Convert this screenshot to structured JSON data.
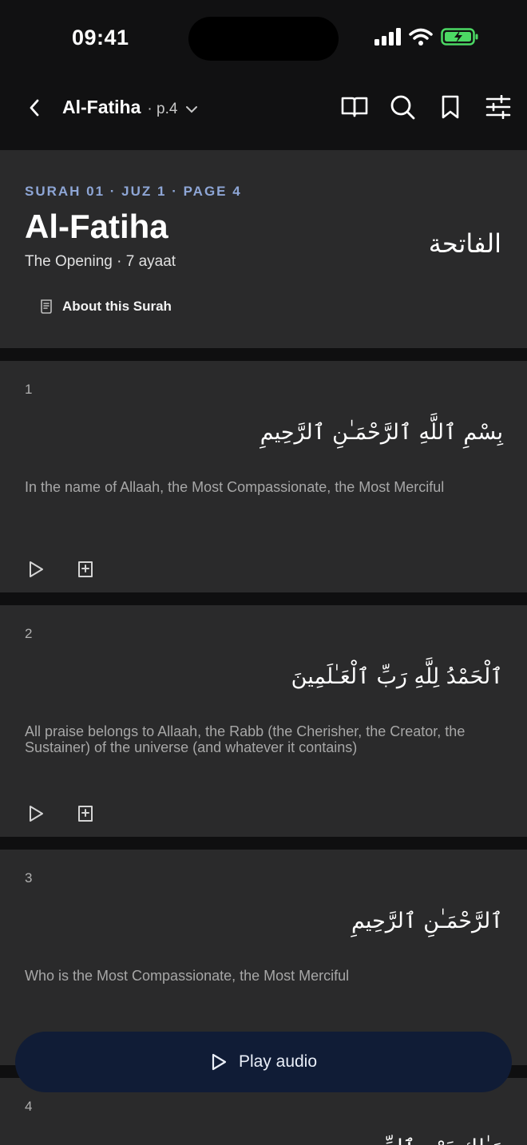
{
  "status_bar": {
    "time": "09:41"
  },
  "nav": {
    "title": "Al-Fatiha",
    "page": "· p.4",
    "icons": [
      "back-icon",
      "book-open-icon",
      "search-icon",
      "bookmark-icon",
      "sliders-icon"
    ]
  },
  "header": {
    "eyebrow": "SURAH 01 · JUZ 1 · PAGE 4",
    "title": "Al-Fatiha",
    "subtitle": "The Opening · 7 ayaat",
    "arabic": "الفاتحة",
    "about_label": "About this Surah"
  },
  "verses": [
    {
      "number": "1",
      "arabic": "بِسْمِ ٱللَّهِ ٱلرَّحْمَـٰنِ ٱلرَّحِيمِ",
      "translation": "In the name of Allaah, the Most Compassionate, the Most Merciful"
    },
    {
      "number": "2",
      "arabic": "ٱلْحَمْدُ لِلَّهِ رَبِّ ٱلْعَـٰلَمِينَ",
      "translation": "All praise belongs to Allaah, the Rabb (the Cherisher, the Creator, the Sustainer) of the universe (and whatever it contains)"
    },
    {
      "number": "3",
      "arabic": "ٱلرَّحْمَـٰنِ ٱلرَّحِيمِ",
      "translation": "Who is the Most Compassionate, the Most Merciful"
    },
    {
      "number": "4",
      "arabic": "مَـٰلِكِ يَوْمِ ٱلدِّينِ",
      "translation": ""
    }
  ],
  "player": {
    "label": "Play audio"
  },
  "colors": {
    "accent_eyebrow": "#8ea6d6",
    "card": "#2a2a2b",
    "player_bg": "#101c36"
  }
}
